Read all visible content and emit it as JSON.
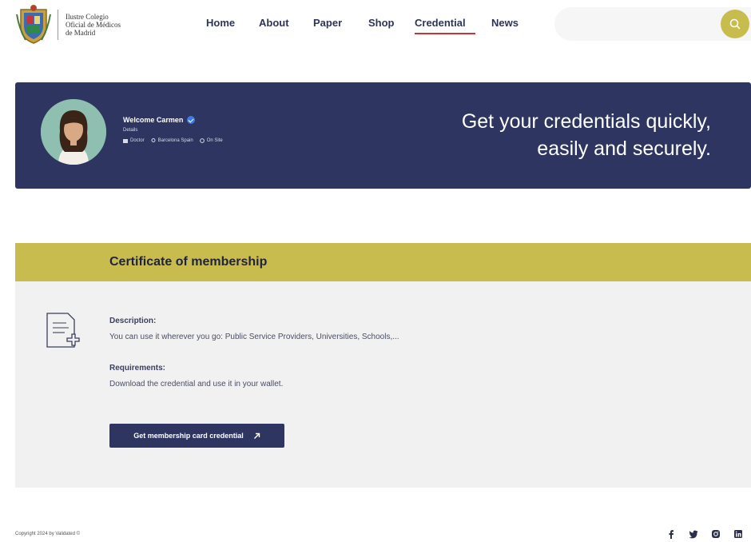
{
  "logo": {
    "lines": [
      "Ilustre Colegio",
      "Oficial de Médicos",
      "de Madrid"
    ]
  },
  "nav": {
    "items": [
      {
        "label": "Home"
      },
      {
        "label": "About"
      },
      {
        "label": "Paper"
      },
      {
        "label": "Shop"
      },
      {
        "label": "Credential",
        "active": true
      },
      {
        "label": "News"
      }
    ]
  },
  "search": {
    "value": "",
    "placeholder": "",
    "icon": "search-icon",
    "accent": "#c9bc4f"
  },
  "banner": {
    "welcome": "Welcome Carmen",
    "role": "Details",
    "meta": [
      "Doctor",
      "Barcelona Spain",
      "On Site"
    ],
    "tagline_line1": "Get your credentials quickly,",
    "tagline_line2": "easily and securely.",
    "background": "#2e3561"
  },
  "certificate": {
    "title": "Certificate of membership",
    "description_label": "Description:",
    "description_text": "You can use it wherever you go: Public Service Providers, Universities, Schools,...",
    "requirements_label": "Requirements:",
    "requirements_text": "Download the credential and use it in your wallet.",
    "button_label": "Get membership card credential",
    "header_color": "#c9bc4f"
  },
  "footer": {
    "copyright": "Copyright 2024 by Validated ©",
    "socials": [
      "facebook-icon",
      "twitter-icon",
      "instagram-icon",
      "linkedin-icon"
    ]
  }
}
